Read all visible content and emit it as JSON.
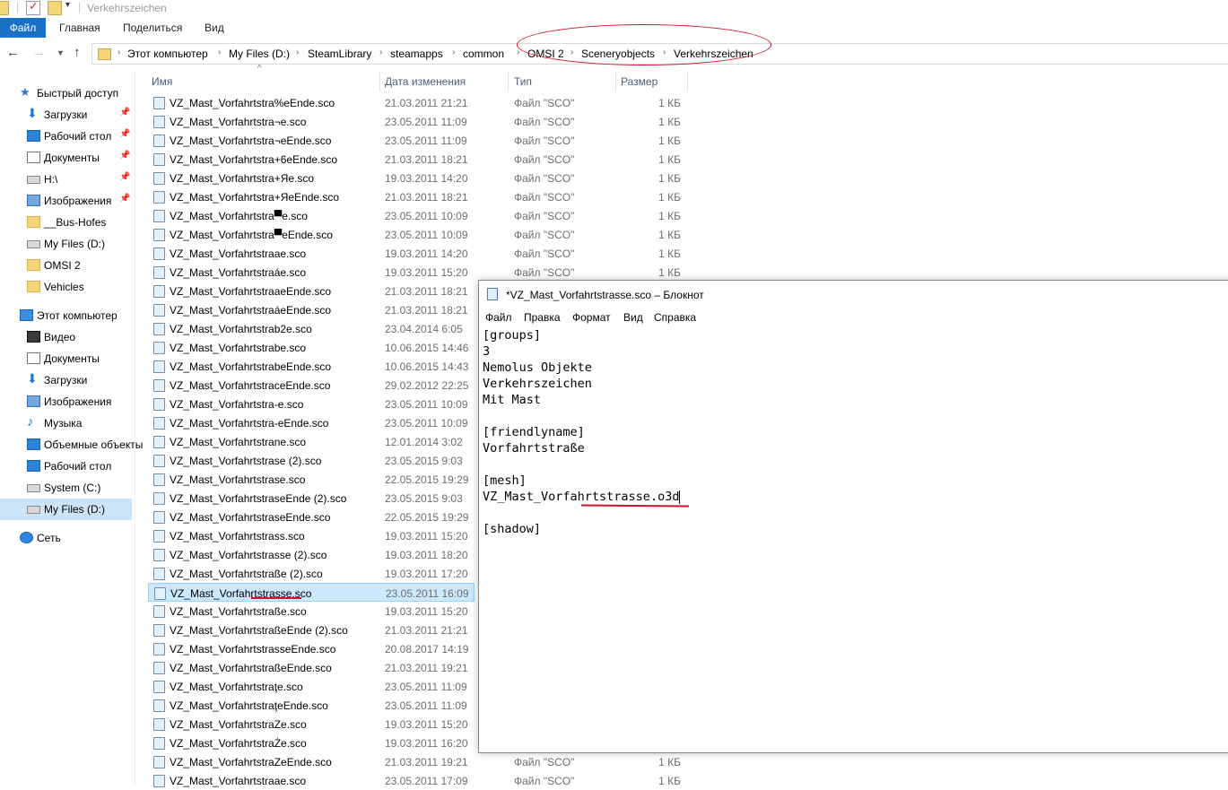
{
  "window": {
    "title": "Verkehrszeichen"
  },
  "ribbon": {
    "tabs": [
      "Файл",
      "Главная",
      "Поделиться",
      "Вид"
    ]
  },
  "breadcrumbs": [
    "Этот компьютер",
    "My Files (D:)",
    "SteamLibrary",
    "steamapps",
    "common",
    "OMSI 2",
    "Sceneryobjects",
    "Verkehrszeichen"
  ],
  "sidebar": {
    "items": [
      {
        "label": "Быстрый доступ",
        "icon": "star-icon",
        "pinned": false
      },
      {
        "label": "Загрузки",
        "icon": "downloads-icon",
        "pinned": true
      },
      {
        "label": "Рабочий стол",
        "icon": "desktop-icon",
        "pinned": true
      },
      {
        "label": "Документы",
        "icon": "documents-icon",
        "pinned": true
      },
      {
        "label": "H:\\",
        "icon": "drive-icon",
        "pinned": true
      },
      {
        "label": "Изображения",
        "icon": "pictures-icon",
        "pinned": true
      },
      {
        "label": "__Bus-Hofes",
        "icon": "folder-icon",
        "pinned": false
      },
      {
        "label": "My Files (D:)",
        "icon": "drive-icon",
        "pinned": false
      },
      {
        "label": "OMSI 2",
        "icon": "folder-icon",
        "pinned": false
      },
      {
        "label": "Vehicles",
        "icon": "folder-icon",
        "pinned": false
      },
      {
        "label": "Этот компьютер",
        "icon": "computer-icon",
        "pinned": false
      },
      {
        "label": "Видео",
        "icon": "video-icon",
        "pinned": false
      },
      {
        "label": "Документы",
        "icon": "documents-icon",
        "pinned": false
      },
      {
        "label": "Загрузки",
        "icon": "downloads-icon",
        "pinned": false
      },
      {
        "label": "Изображения",
        "icon": "pictures-icon",
        "pinned": false
      },
      {
        "label": "Музыка",
        "icon": "music-icon",
        "pinned": false
      },
      {
        "label": "Объемные объекты",
        "icon": "3d-objects-icon",
        "pinned": false
      },
      {
        "label": "Рабочий стол",
        "icon": "desktop-icon",
        "pinned": false
      },
      {
        "label": "System (C:)",
        "icon": "drive-icon",
        "pinned": false
      },
      {
        "label": "My Files (D:)",
        "icon": "drive-icon",
        "pinned": false
      },
      {
        "label": "Сеть",
        "icon": "network-icon",
        "pinned": false
      }
    ]
  },
  "columns": {
    "name": "Имя",
    "date": "Дата изменения",
    "type": "Тип",
    "size": "Размер"
  },
  "files": [
    {
      "name": "VZ_Mast_Vorfahrtstra%eEnde.sco",
      "date": "21.03.2011 21:21",
      "type": "Файл \"SCO\"",
      "size": "1 КБ"
    },
    {
      "name": "VZ_Mast_Vorfahrtstra¬e.sco",
      "date": "23.05.2011 11:09",
      "type": "Файл \"SCO\"",
      "size": "1 КБ"
    },
    {
      "name": "VZ_Mast_Vorfahrtstra¬eEnde.sco",
      "date": "23.05.2011 11:09",
      "type": "Файл \"SCO\"",
      "size": "1 КБ"
    },
    {
      "name": "VZ_Mast_Vorfahrtstra+6eEnde.sco",
      "date": "21.03.2011 18:21",
      "type": "Файл \"SCO\"",
      "size": "1 КБ"
    },
    {
      "name": "VZ_Mast_Vorfahrtstra+Яe.sco",
      "date": "19.03.2011 14:20",
      "type": "Файл \"SCO\"",
      "size": "1 КБ"
    },
    {
      "name": "VZ_Mast_Vorfahrtstra+ЯeEnde.sco",
      "date": "21.03.2011 18:21",
      "type": "Файл \"SCO\"",
      "size": "1 КБ"
    },
    {
      "name": "VZ_Mast_Vorfahrtstra▀e.sco",
      "date": "23.05.2011 10:09",
      "type": "Файл \"SCO\"",
      "size": "1 КБ"
    },
    {
      "name": "VZ_Mast_Vorfahrtstra▀eEnde.sco",
      "date": "23.05.2011 10:09",
      "type": "Файл \"SCO\"",
      "size": "1 КБ"
    },
    {
      "name": "VZ_Mast_Vorfahrtstraae.sco",
      "date": "19.03.2011 14:20",
      "type": "Файл \"SCO\"",
      "size": "1 КБ"
    },
    {
      "name": "VZ_Mast_Vorfahrtstraáe.sco",
      "date": "19.03.2011 15:20",
      "type": "Файл \"SCO\"",
      "size": "1 КБ"
    },
    {
      "name": "VZ_Mast_VorfahrtstraaeEnde.sco",
      "date": "21.03.2011 18:21",
      "type": "",
      "size": ""
    },
    {
      "name": "VZ_Mast_VorfahrtstraáeEnde.sco",
      "date": "21.03.2011 18:21",
      "type": "",
      "size": ""
    },
    {
      "name": "VZ_Mast_Vorfahrtstrab2e.sco",
      "date": "23.04.2014 6:05",
      "type": "",
      "size": ""
    },
    {
      "name": "VZ_Mast_Vorfahrtstrabe.sco",
      "date": "10.06.2015 14:46",
      "type": "",
      "size": ""
    },
    {
      "name": "VZ_Mast_VorfahrtstrabeEnde.sco",
      "date": "10.06.2015 14:43",
      "type": "",
      "size": ""
    },
    {
      "name": "VZ_Mast_VorfahrtstraceEnde.sco",
      "date": "29.02.2012 22:25",
      "type": "",
      "size": ""
    },
    {
      "name": "VZ_Mast_Vorfahrtstra-e.sco",
      "date": "23.05.2011 10:09",
      "type": "",
      "size": ""
    },
    {
      "name": "VZ_Mast_Vorfahrtstra-eEnde.sco",
      "date": "23.05.2011 10:09",
      "type": "",
      "size": ""
    },
    {
      "name": "VZ_Mast_Vorfahrtstrane.sco",
      "date": "12.01.2014 3:02",
      "type": "",
      "size": ""
    },
    {
      "name": "VZ_Mast_Vorfahrtstrase (2).sco",
      "date": "23.05.2015 9:03",
      "type": "",
      "size": ""
    },
    {
      "name": "VZ_Mast_Vorfahrtstrase.sco",
      "date": "22.05.2015 19:29",
      "type": "",
      "size": ""
    },
    {
      "name": "VZ_Mast_VorfahrtstraseEnde (2).sco",
      "date": "23.05.2015 9:03",
      "type": "",
      "size": ""
    },
    {
      "name": "VZ_Mast_VorfahrtstraseEnde.sco",
      "date": "22.05.2015 19:29",
      "type": "",
      "size": ""
    },
    {
      "name": "VZ_Mast_Vorfahrtstrass.sco",
      "date": "19.03.2011 15:20",
      "type": "",
      "size": ""
    },
    {
      "name": "VZ_Mast_Vorfahrtstrasse (2).sco",
      "date": "19.03.2011 18:20",
      "type": "",
      "size": ""
    },
    {
      "name": "VZ_Mast_Vorfahrtstraße (2).sco",
      "date": "19.03.2011 17:20",
      "type": "",
      "size": ""
    },
    {
      "name": "VZ_Mast_Vorfahrtstrasse.sco",
      "date": "23.05.2011 16:09",
      "type": "",
      "size": "",
      "selected": true
    },
    {
      "name": "VZ_Mast_Vorfahrtstraße.sco",
      "date": "19.03.2011 15:20",
      "type": "",
      "size": ""
    },
    {
      "name": "VZ_Mast_VorfahrtstraßeEnde (2).sco",
      "date": "21.03.2011 21:21",
      "type": "",
      "size": ""
    },
    {
      "name": "VZ_Mast_VorfahrtstrasseEnde.sco",
      "date": "20.08.2017 14:19",
      "type": "",
      "size": ""
    },
    {
      "name": "VZ_Mast_VorfahrtstraßeEnde.sco",
      "date": "21.03.2011 19:21",
      "type": "",
      "size": ""
    },
    {
      "name": "VZ_Mast_Vorfahrtstraţe.sco",
      "date": "23.05.2011 11:09",
      "type": "",
      "size": ""
    },
    {
      "name": "VZ_Mast_VorfahrtstraţeEnde.sco",
      "date": "23.05.2011 11:09",
      "type": "",
      "size": ""
    },
    {
      "name": "VZ_Mast_VorfahrtstraZe.sco",
      "date": "19.03.2011 15:20",
      "type": "",
      "size": ""
    },
    {
      "name": "VZ_Mast_VorfahrtstraŻe.sco",
      "date": "19.03.2011 16:20",
      "type": "",
      "size": ""
    },
    {
      "name": "VZ_Mast_VorfahrtstraZeEnde.sco",
      "date": "21.03.2011 19:21",
      "type": "Файл \"SCO\"",
      "size": "1 КБ"
    },
    {
      "name": "VZ_Mast_Vorfahrtstraae.sco",
      "date": "23.05.2011 17:09",
      "type": "Файл \"SCO\"",
      "size": "1 КБ"
    }
  ],
  "notepad": {
    "title": "*VZ_Mast_Vorfahrtstrasse.sco – Блокнот",
    "menu": [
      "Файл",
      "Правка",
      "Формат",
      "Вид",
      "Справка"
    ],
    "lines": [
      "[groups]",
      "3",
      "Nemolus Objekte",
      "Verkehrszeichen",
      "Mit Mast",
      "",
      "[friendlyname]",
      "Vorfahrtstraße",
      "",
      "[mesh]",
      "VZ_Mast_Vorfahrtstrasse.o3d",
      "",
      "[shadow]"
    ]
  },
  "colors": {
    "accent": "#1a6fc7",
    "selection": "#cce8ff",
    "annotation": "#d0142c"
  }
}
